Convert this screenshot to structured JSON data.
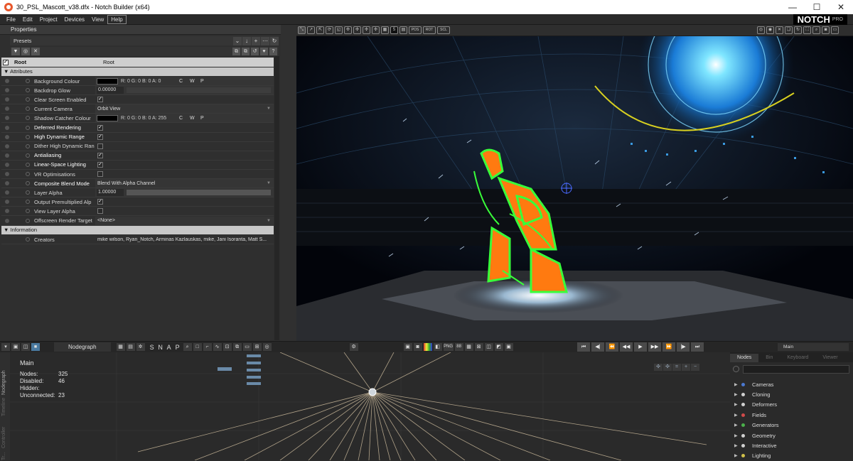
{
  "window": {
    "title": "30_PSL_Mascott_v38.dfx - Notch Builder (x64)",
    "controls": [
      "—",
      "☐",
      "✕"
    ]
  },
  "menu": [
    "File",
    "Edit",
    "Project",
    "Devices",
    "View",
    "Help"
  ],
  "logo": {
    "brand": "NOTCH",
    "edition": "PRO"
  },
  "properties": {
    "title": "Properties",
    "presets_label": "Presets",
    "root": {
      "name": "Root",
      "value": "Root"
    },
    "sections": {
      "attributes": "Attributes",
      "information": "Information"
    },
    "rows": [
      {
        "name": "Background Colour",
        "type": "color",
        "value": "R: 0 G: 0 B: 0 A: 0",
        "cwp": [
          "C",
          "W",
          "P"
        ],
        "highlight": false
      },
      {
        "name": "Backdrop Glow",
        "type": "number",
        "value": "0.00000",
        "highlight": false
      },
      {
        "name": "Clear Screen Enabled",
        "type": "check",
        "checked": true,
        "highlight": false
      },
      {
        "name": "Current Camera",
        "type": "dropdown",
        "value": "Orbit View",
        "highlight": false
      },
      {
        "name": "Shadow Catcher Colour",
        "type": "color",
        "value": "R: 0 G: 0 B: 0 A: 255",
        "cwp": [
          "C",
          "W",
          "P"
        ],
        "highlight": false
      },
      {
        "name": "Deferred Rendering",
        "type": "check",
        "checked": true,
        "highlight": true
      },
      {
        "name": "High Dynamic Range",
        "type": "check",
        "checked": true,
        "highlight": true
      },
      {
        "name": "Dither High Dynamic Ran",
        "type": "check",
        "checked": false,
        "highlight": false
      },
      {
        "name": "Antialiasing",
        "type": "check",
        "checked": true,
        "highlight": true
      },
      {
        "name": "Linear-Space Lighting",
        "type": "check",
        "checked": true,
        "highlight": true
      },
      {
        "name": "VR Optimisations",
        "type": "check",
        "checked": false,
        "highlight": false
      },
      {
        "name": "Composite Blend Mode",
        "type": "dropdown",
        "value": "Blend With Alpha Channel",
        "highlight": true
      },
      {
        "name": "Layer Alpha",
        "type": "number",
        "value": "1.00000",
        "highlight": false
      },
      {
        "name": "Output Premultiplied Alp",
        "type": "check",
        "checked": true,
        "highlight": false
      },
      {
        "name": "View Layer Alpha",
        "type": "check",
        "checked": false,
        "highlight": false
      },
      {
        "name": "Offscreen Render Target",
        "type": "dropdown",
        "value": "<None>",
        "highlight": false
      }
    ],
    "creators": {
      "name": "Creators",
      "value": "mike wilson, Ryan_Notch, Arminas Kazlauskas, mike, Jani Isoranta, Matt S..."
    }
  },
  "viewport_toolbar": {
    "frame_field": "5",
    "labels": [
      "POS",
      "ROT",
      "SCL"
    ]
  },
  "bottom_toolbar": {
    "nodegraph_tab": "Nodegraph",
    "snap_letters": [
      "S",
      "N",
      "A",
      "P"
    ],
    "quality": "PNG",
    "quality_value": "88",
    "layer_label": "Main",
    "transport": [
      "⏮",
      "◀|",
      "⏪",
      "◀◀",
      "▶",
      "▶▶",
      "⏩",
      "|▶",
      "⏭"
    ]
  },
  "nodegraph": {
    "title": "Main",
    "stats": [
      {
        "label": "Nodes:",
        "value": "325"
      },
      {
        "label": "Disabled:",
        "value": "46"
      },
      {
        "label": "Hidden:",
        "value": ""
      },
      {
        "label": "Unconnected:",
        "value": "23"
      }
    ],
    "side_tabs": [
      "Nodegraph",
      "Timeline",
      "Controller",
      "Tr..."
    ]
  },
  "nodes_panel": {
    "tabs": [
      "Nodes",
      "Bin",
      "Keyboard",
      "Viewer"
    ],
    "categories": [
      {
        "label": "Cameras",
        "color": "#4a78d0"
      },
      {
        "label": "Cloning",
        "color": "#cfcfcf"
      },
      {
        "label": "Deformers",
        "color": "#cfcfcf"
      },
      {
        "label": "Fields",
        "color": "#d04a4a"
      },
      {
        "label": "Generators",
        "color": "#4ab04a"
      },
      {
        "label": "Geometry",
        "color": "#cfcfcf"
      },
      {
        "label": "Interactive",
        "color": "#cfcfcf"
      },
      {
        "label": "Lighting",
        "color": "#d0c04a"
      }
    ]
  }
}
